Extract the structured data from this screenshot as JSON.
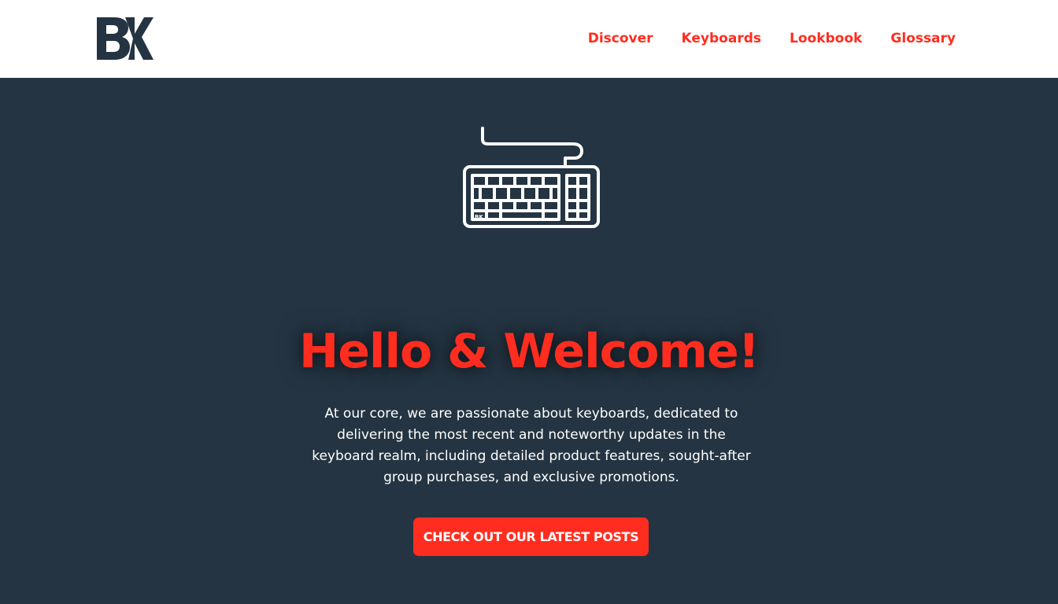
{
  "header": {
    "logo_text": "BK",
    "nav": [
      {
        "label": "Discover"
      },
      {
        "label": "Keyboards"
      },
      {
        "label": "Lookbook"
      },
      {
        "label": "Glossary"
      }
    ]
  },
  "hero": {
    "icon": "keyboard-icon",
    "icon_badge": "BK",
    "title": "Hello & Welcome!",
    "description": "At our core, we are passionate about keyboards, dedicated to delivering the most recent and noteworthy updates in the keyboard realm, including detailed product features, sought-after group purchases, and exclusive promotions.",
    "cta_label": "CHECK OUT OUR LATEST POSTS"
  },
  "colors": {
    "accent": "#ff2d1f",
    "background": "#243442",
    "header_bg": "#ffffff",
    "logo": "#243442"
  }
}
